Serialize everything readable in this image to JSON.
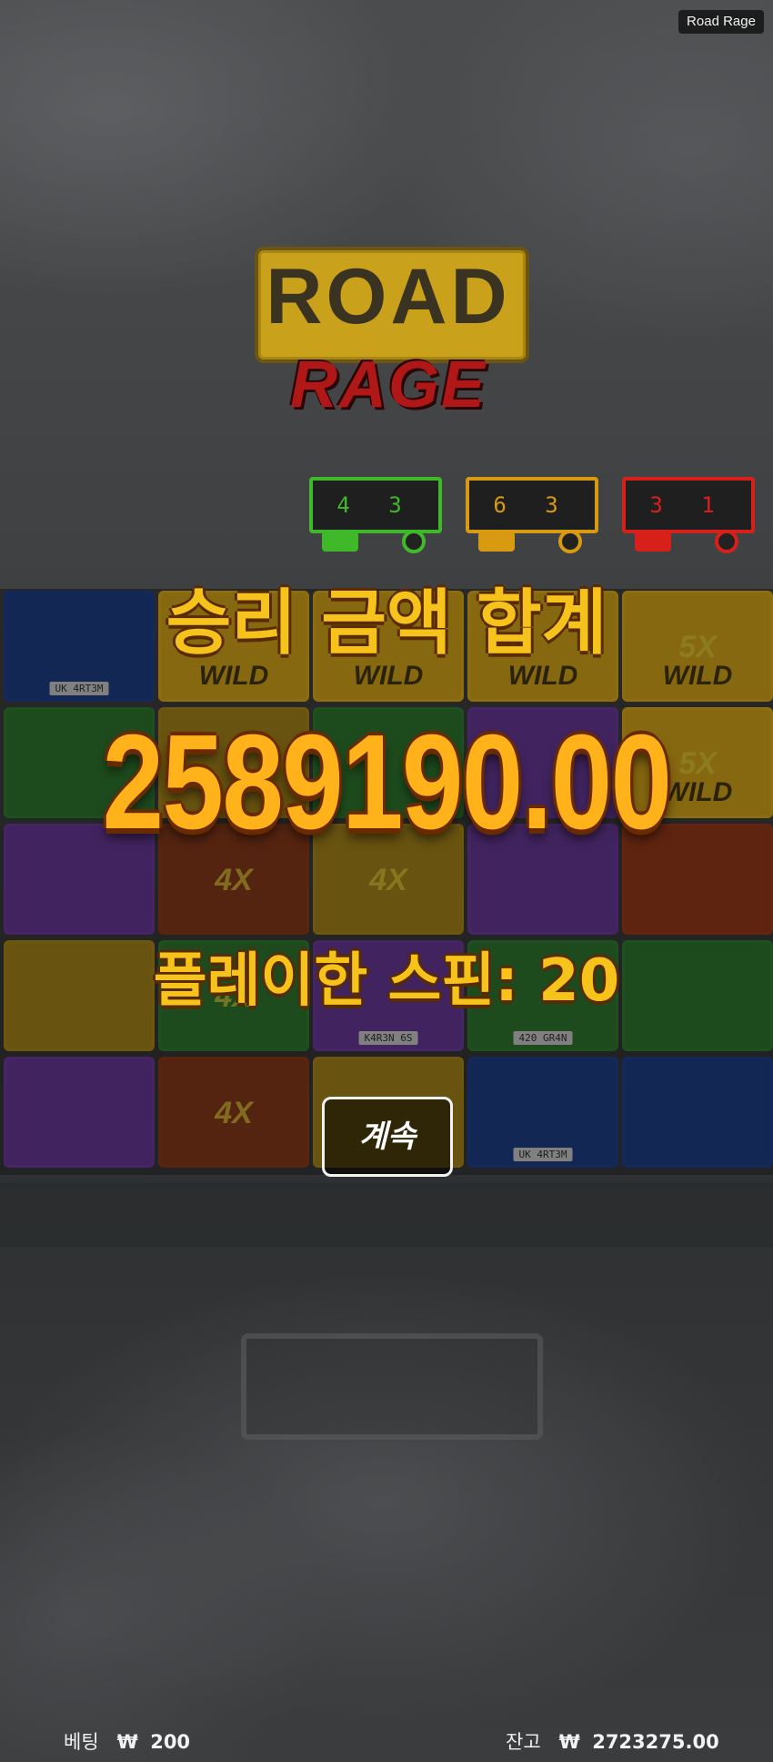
{
  "game_tag": "Road Rage",
  "logo": {
    "top_word": "ROAD",
    "bottom_word": "RAGE"
  },
  "counters": [
    {
      "digits": "4 3",
      "color": "#3fb82a"
    },
    {
      "digits": "6 3",
      "color": "#d89a10"
    },
    {
      "digits": "3 1",
      "color": "#d8201a"
    }
  ],
  "reels": {
    "rows": [
      [
        {
          "type": "driver",
          "bg": "#1f3f8a",
          "plate": "UK 4RT3M"
        },
        {
          "type": "wild",
          "bg": "#d9a81a",
          "label": "WILD"
        },
        {
          "type": "wild",
          "bg": "#d9a81a",
          "label": "WILD"
        },
        {
          "type": "wild",
          "bg": "#d9a81a",
          "label": "WILD"
        },
        {
          "type": "wild5x",
          "bg": "#d9a81a",
          "label": "WILD",
          "multiplier": "5X"
        }
      ],
      [
        {
          "type": "air-freshener",
          "bg": "#2f7a2f"
        },
        {
          "type": "tire",
          "bg": "#a8861a"
        },
        {
          "type": "tire",
          "bg": "#2f7a2f"
        },
        {
          "type": "phone",
          "bg": "#6a3a9a"
        },
        {
          "type": "wild5x",
          "bg": "#d9a81a",
          "label": "WILD",
          "multiplier": "5X"
        }
      ],
      [
        {
          "type": "phone",
          "bg": "#6a3a9a"
        },
        {
          "type": "coffee4x",
          "bg": "#8a3a1a",
          "multiplier": "4X"
        },
        {
          "type": "tire4x",
          "bg": "#a8861a",
          "multiplier": "4X"
        },
        {
          "type": "phone",
          "bg": "#6a3a9a"
        },
        {
          "type": "coffee",
          "bg": "#9a3a1a"
        }
      ],
      [
        {
          "type": "tire",
          "bg": "#a8861a"
        },
        {
          "type": "coffee4x",
          "bg": "#2f7a2f",
          "multiplier": "4X"
        },
        {
          "type": "karen",
          "bg": "#6a3a9a",
          "plate": "K4R3N 6S"
        },
        {
          "type": "granny",
          "bg": "#2f7a2f",
          "plate": "420 GR4N"
        },
        {
          "type": "air-freshener",
          "bg": "#2f7a2f"
        }
      ],
      [
        {
          "type": "phone",
          "bg": "#6a3a9a"
        },
        {
          "type": "coffee4x",
          "bg": "#8a3a1a",
          "multiplier": "4X"
        },
        {
          "type": "tire",
          "bg": "#a8861a"
        },
        {
          "type": "driver",
          "bg": "#1f3f8a",
          "plate": "UK 4RT3M"
        },
        {
          "type": "mirror",
          "bg": "#1f3f8a"
        }
      ]
    ]
  },
  "win_popup": {
    "title": "승리 금액 합계",
    "amount": "2589190.00",
    "spins_text": "플레이한 스핀: 20",
    "continue_label": "계속"
  },
  "footer": {
    "bet_label": "베팅",
    "bet_currency": "₩",
    "bet_value": "200",
    "balance_label": "잔고",
    "balance_currency": "₩",
    "balance_value": "2723275.00"
  }
}
